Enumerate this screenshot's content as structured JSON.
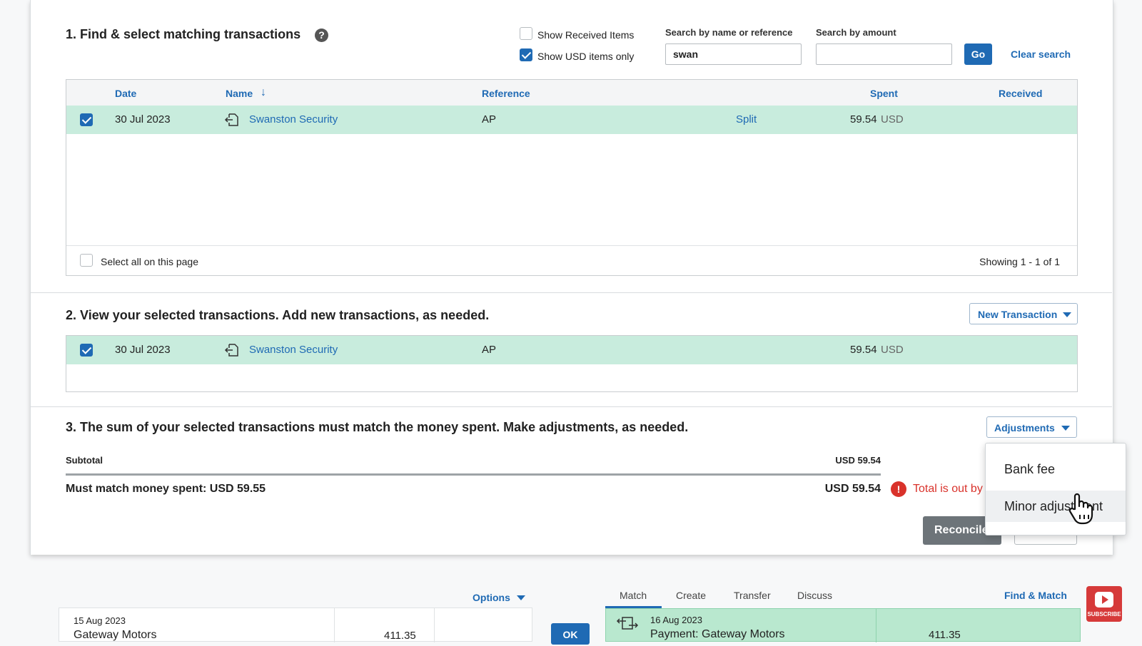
{
  "section1": {
    "title": "1. Find & select matching transactions",
    "show_received_label": "Show Received Items",
    "show_received_checked": false,
    "show_usd_label": "Show USD items only",
    "show_usd_checked": true,
    "search_name_label": "Search by name or reference",
    "search_name_value": "swan",
    "search_amount_label": "Search by amount",
    "search_amount_value": "",
    "go_label": "Go",
    "clear_search_label": "Clear search",
    "columns": {
      "date": "Date",
      "name": "Name",
      "reference": "Reference",
      "spent": "Spent",
      "received": "Received"
    },
    "rows": [
      {
        "checked": true,
        "date": "30 Jul 2023",
        "name": "Swanston Security",
        "reference": "AP",
        "split": "Split",
        "spent_amount": "59.54",
        "spent_currency": "USD"
      }
    ],
    "select_all_label": "Select all on this page",
    "showing": "Showing 1 - 1 of 1"
  },
  "section2": {
    "title": "2. View your selected transactions. Add new transactions, as needed.",
    "new_transaction_label": "New Transaction",
    "rows": [
      {
        "checked": true,
        "date": "30 Jul 2023",
        "name": "Swanston Security",
        "reference": "AP",
        "amount": "59.54",
        "currency": "USD"
      }
    ]
  },
  "section3": {
    "title": "3. The sum of your selected transactions must match the money spent. Make adjustments, as needed.",
    "adjustments_label": "Adjustments",
    "subtotal_label": "Subtotal",
    "subtotal_value": "USD 59.54",
    "must_match_label": "Must match money spent: USD 59.55",
    "total_value": "USD 59.54",
    "error_text": "Total is out by",
    "reconcile_label": "Reconcile",
    "adjustments_menu": [
      "Bank fee",
      "Minor adjustment"
    ]
  },
  "bottom": {
    "options_label": "Options",
    "statement": {
      "date": "15 Aug 2023",
      "payee": "Gateway Motors",
      "amount": "411.35"
    },
    "ok_label": "OK",
    "tabs": [
      "Match",
      "Create",
      "Transfer",
      "Discuss"
    ],
    "active_tab": "Match",
    "find_match_label": "Find & Match",
    "match": {
      "date": "16 Aug 2023",
      "description": "Payment: Gateway Motors",
      "amount": "411.35"
    },
    "subscribe_label": "SUBSCRIBE"
  },
  "colors": {
    "link_blue": "#1f6ab4",
    "row_green": "#c8ecdd",
    "error_red": "#d9322b",
    "reconcile_grey": "#6d7479"
  }
}
